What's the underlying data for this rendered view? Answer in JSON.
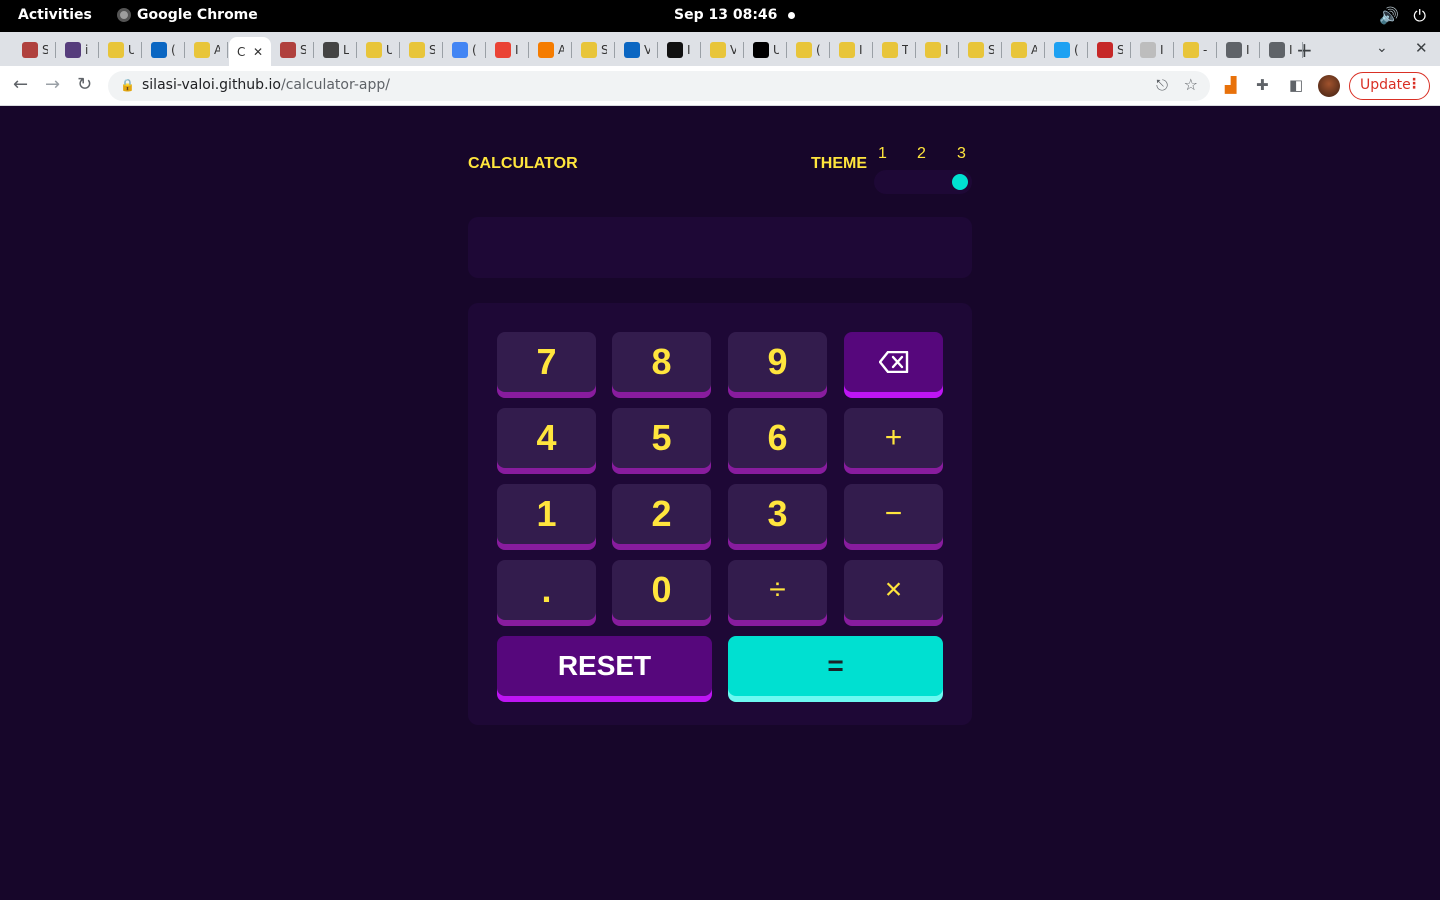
{
  "system": {
    "activities": "Activities",
    "app_name": "Google Chrome",
    "clock": "Sep 13  08:46"
  },
  "browser": {
    "url_host": "silasi-valoi.github.io",
    "url_path": "/calculator-app/",
    "update_label": "Update",
    "tabs": [
      {
        "letter": "S",
        "color": "#b0413e"
      },
      {
        "letter": "i",
        "color": "#563d7c"
      },
      {
        "letter": "U",
        "color": "#e8c53a"
      },
      {
        "letter": "(",
        "color": "#0a66c2"
      },
      {
        "letter": "A",
        "color": "#e8c53a"
      },
      {
        "letter": "C",
        "color": "#ffffff"
      },
      {
        "letter": "S",
        "color": "#b0413e"
      },
      {
        "letter": "L",
        "color": "#444444"
      },
      {
        "letter": "U",
        "color": "#e8c53a"
      },
      {
        "letter": "S",
        "color": "#e8c53a"
      },
      {
        "letter": "(",
        "color": "#4285f4"
      },
      {
        "letter": "I",
        "color": "#ea4335"
      },
      {
        "letter": "A",
        "color": "#f57c00"
      },
      {
        "letter": "S",
        "color": "#e8c53a"
      },
      {
        "letter": "V",
        "color": "#0a66c2"
      },
      {
        "letter": "I",
        "color": "#111111"
      },
      {
        "letter": "V",
        "color": "#e8c53a"
      },
      {
        "letter": "U",
        "color": "#000000"
      },
      {
        "letter": "(",
        "color": "#e8c53a"
      },
      {
        "letter": "I",
        "color": "#e8c53a"
      },
      {
        "letter": "T",
        "color": "#e8c53a"
      },
      {
        "letter": "I",
        "color": "#e8c53a"
      },
      {
        "letter": "S",
        "color": "#e8c53a"
      },
      {
        "letter": "A",
        "color": "#e8c53a"
      },
      {
        "letter": "(",
        "color": "#1da1f2"
      },
      {
        "letter": "S",
        "color": "#c62828"
      },
      {
        "letter": "I",
        "color": "#bdbdbd"
      },
      {
        "letter": "-",
        "color": "#e8c53a"
      },
      {
        "letter": "I",
        "color": "#5f6368"
      },
      {
        "letter": "I",
        "color": "#5f6368"
      }
    ]
  },
  "calculator": {
    "title": "calculator",
    "theme_label": "THEME",
    "theme_options": [
      "1",
      "2",
      "3"
    ],
    "selected_theme": 3,
    "display_value": "",
    "keys": {
      "seven": "7",
      "eight": "8",
      "nine": "9",
      "four": "4",
      "five": "5",
      "six": "6",
      "plus": "+",
      "one": "1",
      "two": "2",
      "three": "3",
      "minus": "−",
      "dot": ".",
      "zero": "0",
      "divide": "÷",
      "multiply": "×",
      "reset": "RESET",
      "equals": "="
    },
    "colors": {
      "background": "#17062a",
      "panel": "#1e0836",
      "key": "#331c4d",
      "key_shadow": "#881c9e",
      "key_text": "#ffe53d",
      "function_key": "#56077c",
      "function_shadow": "#be15f4",
      "equals_key": "#00e0d1",
      "equals_shadow": "#6cf9f1"
    }
  }
}
